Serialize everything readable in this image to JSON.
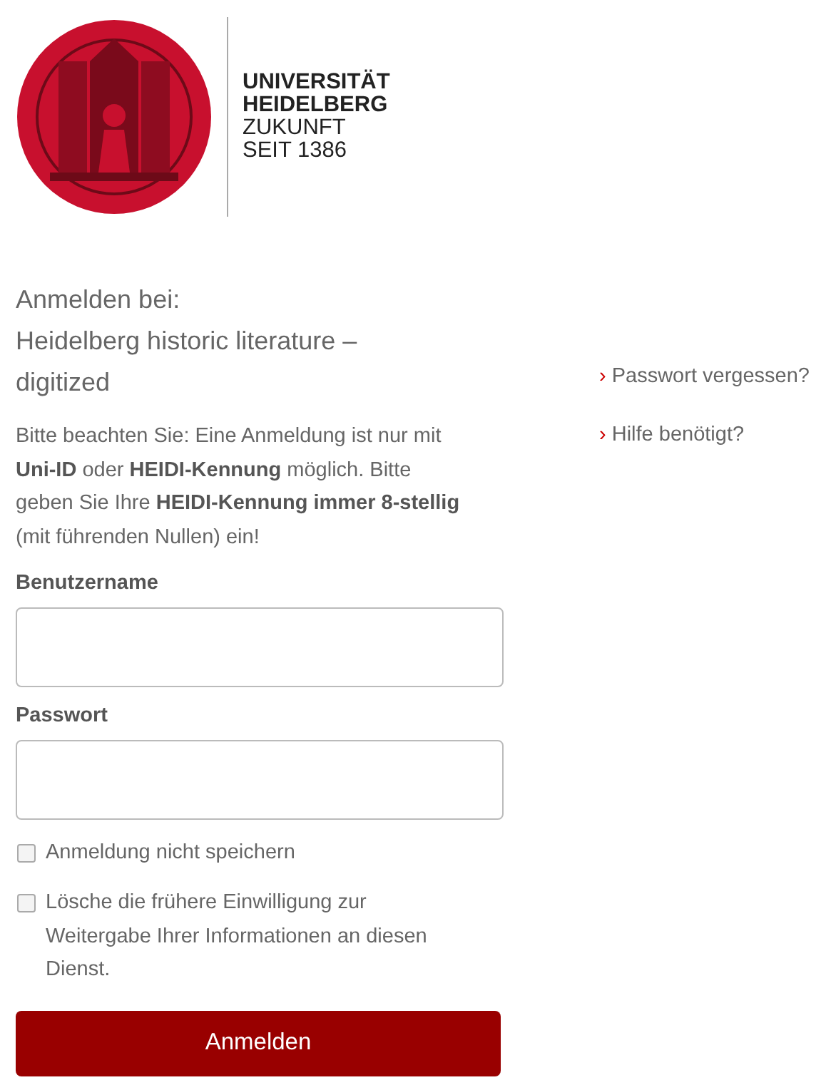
{
  "logo": {
    "lines": [
      "UNIVERSITÄT",
      "HEIDELBERG",
      "ZUKUNFT",
      "SEIT 1386"
    ]
  },
  "heading": [
    "Anmelden bei:",
    "Heidelberg historic literature –",
    "digitized"
  ],
  "notice": "Bitte beachten Sie: Eine Anmeldung ist nur mit **Uni-ID** oder **HEIDI-Kennung** möglich. Bitte geben Sie Ihre **HEIDI-Kennung immer 8-stellig** (mit führenden Nullen) ein!",
  "fields": [
    {
      "label": "Benutzername"
    },
    {
      "label": "Passwort"
    }
  ],
  "checkboxes": [
    {
      "label": "Anmeldung nicht speichern",
      "checked": false
    },
    {
      "label": "Lösche die frühere Einwilligung zur Weitergabe Ihrer Informationen an diesen Dienst.",
      "checked": false
    }
  ],
  "submit": "Anmelden",
  "links": [
    {
      "marker": "›",
      "label": "Passwort vergessen?"
    },
    {
      "marker": "›",
      "label": "Hilfe benötigt?"
    }
  ]
}
